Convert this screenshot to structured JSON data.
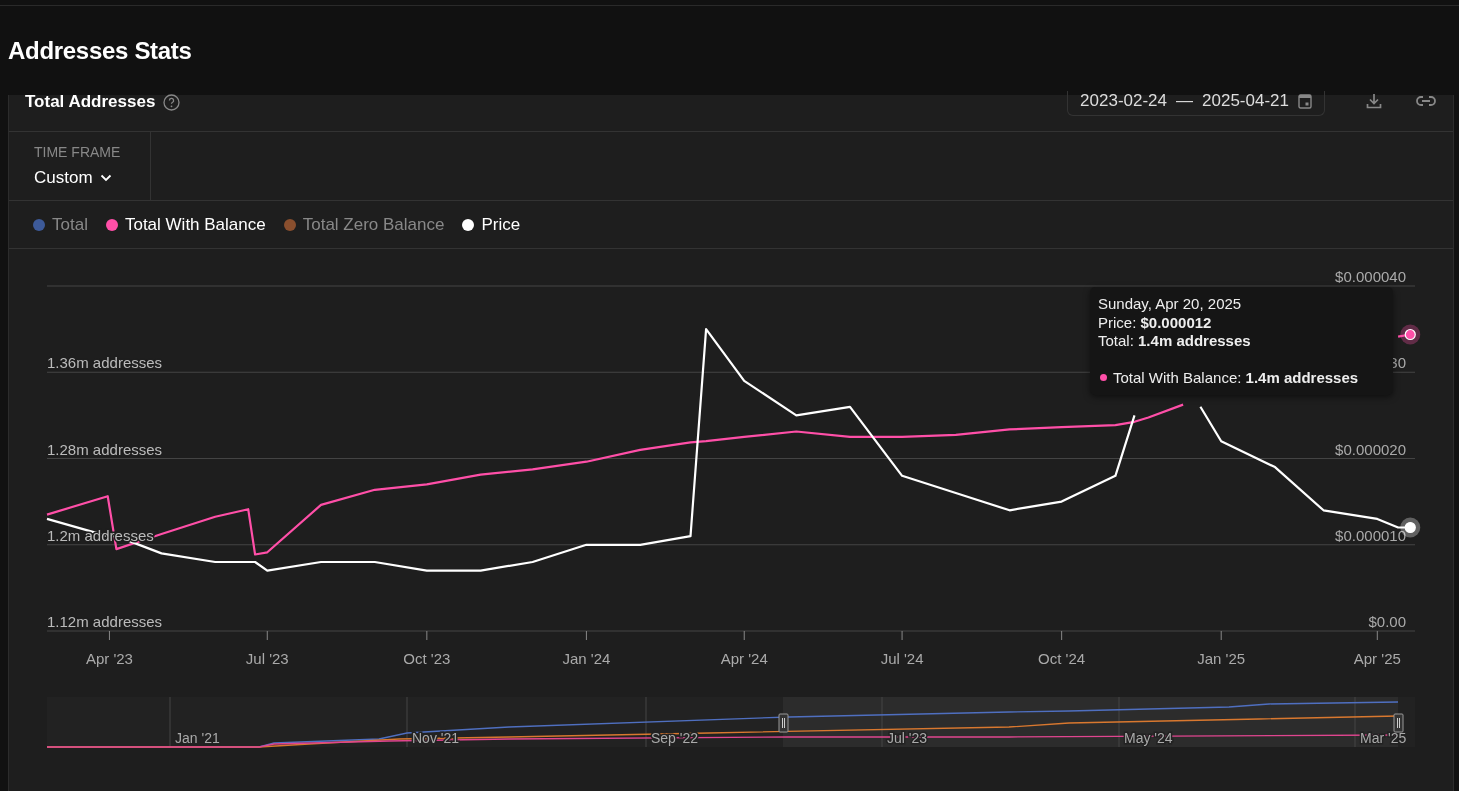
{
  "page_title": "Addresses Stats",
  "card": {
    "title": "Total Addresses",
    "date_range": {
      "start": "2023-02-24",
      "separator": "—",
      "end": "2025-04-21"
    },
    "time_frame": {
      "label": "TIME FRAME",
      "value": "Custom"
    },
    "legend": [
      {
        "label": "Total",
        "color": "#3d5a99",
        "active": false
      },
      {
        "label": "Total With Balance",
        "color": "#ff4fa8",
        "active": true
      },
      {
        "label": "Total Zero Balance",
        "color": "#8a4f2e",
        "active": false
      },
      {
        "label": "Price",
        "color": "#ffffff",
        "active": true
      }
    ],
    "chart_data": {
      "type": "line",
      "x": [
        "2023-02-24",
        "2023-03-31",
        "2023-04-05",
        "2023-05-01",
        "2023-06-01",
        "2023-06-20",
        "2023-06-24",
        "2023-07-01",
        "2023-08-01",
        "2023-09-01",
        "2023-10-01",
        "2023-11-01",
        "2023-12-01",
        "2024-01-01",
        "2024-02-01",
        "2024-03-01",
        "2024-03-10",
        "2024-04-01",
        "2024-05-01",
        "2024-06-01",
        "2024-07-01",
        "2024-08-01",
        "2024-09-01",
        "2024-10-01",
        "2024-11-01",
        "2024-11-12",
        "2024-11-20",
        "2024-12-10",
        "2024-12-20",
        "2025-01-01",
        "2025-02-01",
        "2025-03-01",
        "2025-04-01",
        "2025-04-13",
        "2025-04-20"
      ],
      "grid": true,
      "xlim": [
        "2023-02-24",
        "2025-04-21"
      ],
      "xticks": [
        {
          "value": "2023-04-01",
          "label": "Apr '23"
        },
        {
          "value": "2023-07-01",
          "label": "Jul '23"
        },
        {
          "value": "2023-10-01",
          "label": "Oct '23"
        },
        {
          "value": "2024-01-01",
          "label": "Jan '24"
        },
        {
          "value": "2024-04-01",
          "label": "Apr '24"
        },
        {
          "value": "2024-07-01",
          "label": "Jul '24"
        },
        {
          "value": "2024-10-01",
          "label": "Oct '24"
        },
        {
          "value": "2025-01-01",
          "label": "Jan '25"
        },
        {
          "value": "2025-04-01",
          "label": "Apr '25"
        }
      ],
      "ylim": [
        1.12,
        1.44
      ],
      "yticks": [
        {
          "value": 1.12,
          "label": "1.12m addresses"
        },
        {
          "value": 1.2,
          "label": "1.2m addresses"
        },
        {
          "value": 1.28,
          "label": "1.28m addresses"
        },
        {
          "value": 1.36,
          "label": "1.36m addresses"
        }
      ],
      "y2lim": [
        0,
        4e-05
      ],
      "y2ticks": [
        {
          "value": 0,
          "label": "$0.00"
        },
        {
          "value": 1e-05,
          "label": "$0.000010"
        },
        {
          "value": 2e-05,
          "label": "$0.000020"
        },
        {
          "value": 4e-05,
          "label": "$0.000040"
        }
      ],
      "series": [
        {
          "name": "Total With Balance",
          "color": "#ff4fa8",
          "values": [
            1.228,
            1.245,
            1.196,
            1.21,
            1.226,
            1.233,
            1.191,
            1.193,
            1.237,
            1.251,
            1.256,
            1.265,
            1.27,
            1.277,
            1.288,
            1.295,
            1.296,
            1.3,
            1.305,
            1.3,
            1.3,
            1.302,
            1.307,
            1.309,
            1.311,
            1.314,
            1.318,
            1.33,
            null,
            null,
            null,
            null,
            null,
            1.393,
            1.395
          ]
        },
        {
          "name": "Price",
          "color": "#ffffff",
          "axis": "y2",
          "values": [
            1.3e-05,
            1.1e-05,
            1.1e-05,
            9e-06,
            8e-06,
            8e-06,
            8e-06,
            7e-06,
            8e-06,
            8e-06,
            7e-06,
            7e-06,
            8e-06,
            1e-05,
            1e-05,
            1.1e-05,
            3.5e-05,
            2.9e-05,
            2.5e-05,
            2.6e-05,
            1.8e-05,
            1.6e-05,
            1.4e-05,
            1.5e-05,
            1.8e-05,
            2.5e-05,
            null,
            null,
            2.6e-05,
            2.2e-05,
            1.9e-05,
            1.4e-05,
            1.3e-05,
            1.2e-05,
            1.2e-05
          ]
        }
      ]
    },
    "covered_tick_text": "30",
    "tooltip": {
      "date": "Sunday, Apr 20, 2025",
      "price_value": ": **$0.000012**",
      "total_line": "Total: **1.4m addresses**",
      "balance_value": ": **1.4m addresses**"
    },
    "navigator": {
      "labels": [
        "Jan '21",
        "Nov '21",
        "Sep '22",
        "Jul '23",
        "May '24",
        "Mar '25"
      ]
    }
  }
}
